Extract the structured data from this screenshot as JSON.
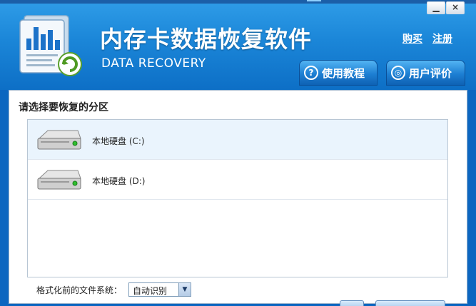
{
  "header": {
    "title": "内存卡数据恢复软件",
    "subtitle": "DATA RECOVERY",
    "links": {
      "buy": "购买",
      "register": "注册"
    },
    "window_controls": {
      "minimize": "▁",
      "close": "×"
    },
    "buttons": {
      "help": {
        "label": "使用教程",
        "icon": "question-icon",
        "glyph": "?"
      },
      "review": {
        "label": "用户评价",
        "icon": "feedback-icon",
        "glyph": "◎"
      }
    }
  },
  "main": {
    "section_title": "请选择要恢复的分区",
    "partitions": [
      {
        "label": "本地硬盘 (C:)",
        "selected": true,
        "icon": "hard-drive-icon"
      },
      {
        "label": "本地硬盘 (D:)",
        "selected": false,
        "icon": "hard-drive-icon"
      }
    ],
    "filesystem": {
      "label": "格式化前的文件系统：",
      "selected": "自动识别"
    }
  },
  "colors": {
    "header_top": "#2f9de8",
    "header_bottom": "#0d6fc6",
    "selected_row": "#eaf4fd"
  }
}
